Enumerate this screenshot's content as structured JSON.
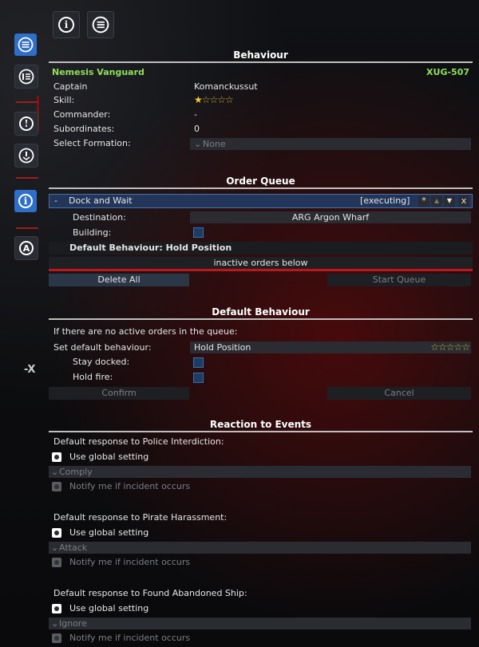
{
  "rail": {
    "items": [
      "list-icon",
      "info-list-icon",
      "alert-icon",
      "shield-alert-icon",
      "info-icon",
      "logo-icon"
    ]
  },
  "side_close": "-X",
  "behaviour": {
    "title": "Behaviour",
    "ship_name": "Nemesis Vanguard",
    "ship_id": "XUG-507",
    "captain_label": "Captain",
    "captain_value": "Komanckussut",
    "skill_label": "Skill:",
    "skill_stars_filled": 1,
    "skill_stars_total": 5,
    "commander_label": "Commander:",
    "commander_value": "-",
    "subordinates_label": "Subordinates:",
    "subordinates_value": "0",
    "formation_label": "Select Formation:",
    "formation_value": "None"
  },
  "order_queue": {
    "title": "Order Queue",
    "collapse": "-",
    "order_name": "Dock and Wait",
    "order_status": "[executing]",
    "btn_star": "*",
    "btn_up": "▲",
    "btn_down": "▼",
    "btn_close": "x",
    "destination_label": "Destination:",
    "destination_value": "ARG Argon Wharf",
    "building_label": "Building:",
    "default_behaviour_row": "Default Behaviour: Hold Position",
    "inactive_label": "inactive orders below",
    "delete_all": "Delete All",
    "start_queue": "Start Queue"
  },
  "default_behaviour": {
    "title": "Default Behaviour",
    "intro": "If there are no active orders in the queue:",
    "set_label": "Set default behaviour:",
    "set_value": "Hold Position",
    "stars_filled": 0,
    "stars_total": 5,
    "stay_docked_label": "Stay docked:",
    "hold_fire_label": "Hold fire:",
    "confirm": "Confirm",
    "cancel": "Cancel"
  },
  "reactions": {
    "title": "Reaction to Events",
    "groups": [
      {
        "heading": "Default response to Police Interdiction:",
        "use_global": "Use global setting",
        "option": "Comply",
        "notify": "Notify me if incident occurs"
      },
      {
        "heading": "Default response to Pirate Harassment:",
        "use_global": "Use global setting",
        "option": "Attack",
        "notify": "Notify me if incident occurs"
      },
      {
        "heading": "Default response to Found Abandoned Ship:",
        "use_global": "Use global setting",
        "option": "Ignore",
        "notify": "Notify me if incident occurs"
      }
    ]
  },
  "colors": {
    "ship_name_green": "#8fe05a",
    "accent_blue": "#2f6fc9",
    "separator_red": "#c0161a",
    "star_gold": "#f3d12b"
  }
}
